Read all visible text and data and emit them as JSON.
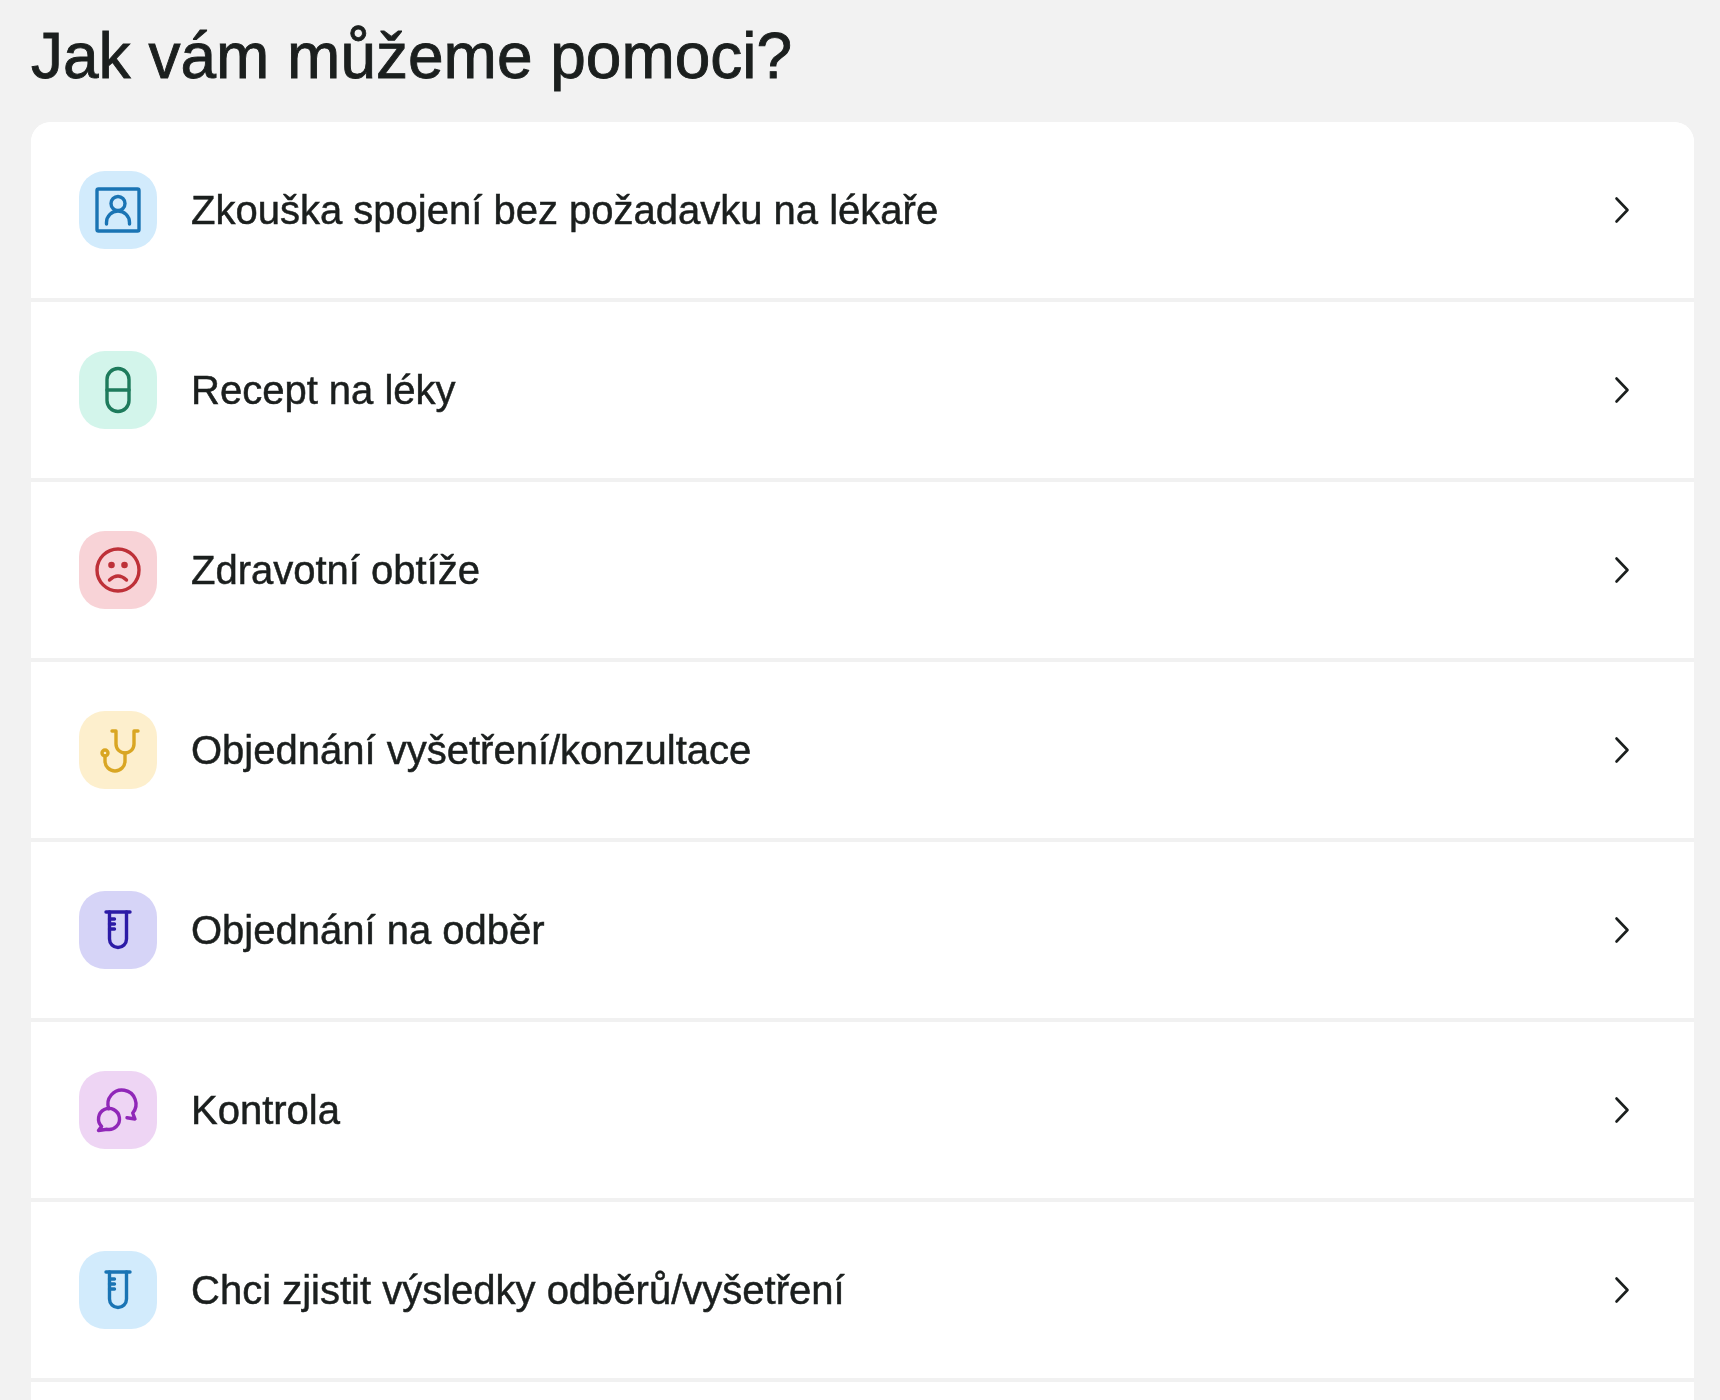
{
  "title": "Jak vám můžeme pomoci?",
  "options": [
    {
      "label": "Zkouška spojení bez požadavku na lékaře",
      "color": "#d2ebfc",
      "icon": {
        "kind": "portrait",
        "color": "#1a74b4"
      }
    },
    {
      "label": "Recept na léky",
      "color": "#d3f5eb",
      "icon": {
        "kind": "pill",
        "color": "#1e7b5c"
      }
    },
    {
      "label": "Zdravotní obtíže",
      "color": "#f8d3d7",
      "icon": {
        "kind": "sad-face",
        "color": "#be3038"
      }
    },
    {
      "label": "Objednání vyšetření/konzultace",
      "color": "#fdefcd",
      "icon": {
        "kind": "stethoscope",
        "color": "#d9a623"
      }
    },
    {
      "label": "Objednání na odběr",
      "color": "#d6d4f7",
      "icon": {
        "kind": "test-tube",
        "color": "#2c1ba6"
      }
    },
    {
      "label": "Kontrola",
      "color": "#eed5f4",
      "icon": {
        "kind": "chat",
        "color": "#9027b8"
      }
    },
    {
      "label": "Chci zjistit výsledky odběrů/vyšetření",
      "color": "#d2ebfc",
      "icon": {
        "kind": "test-tube",
        "color": "#1a74b4"
      }
    }
  ]
}
